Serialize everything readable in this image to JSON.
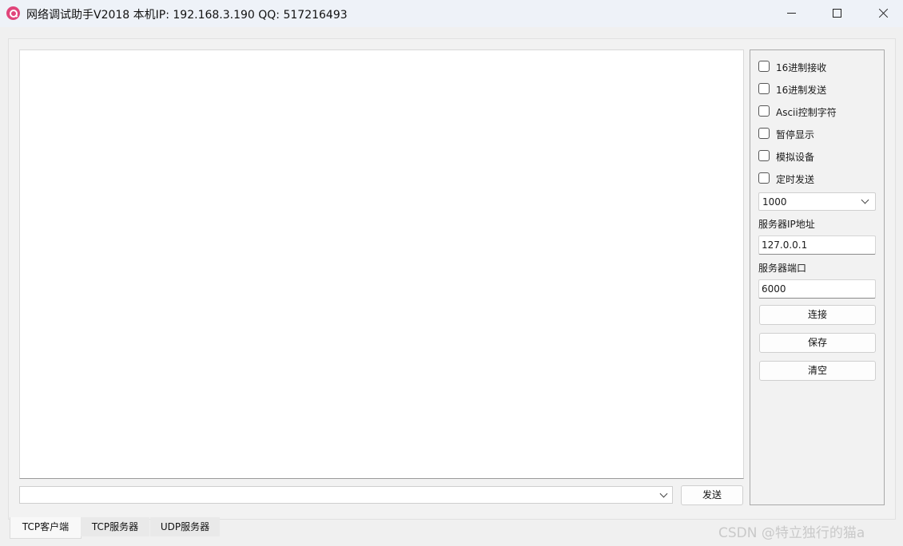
{
  "window": {
    "title": "网络调试助手V2018  本机IP: 192.168.3.190  QQ: 517216493"
  },
  "send": {
    "input_value": "",
    "send_label": "发送"
  },
  "options": [
    {
      "label": "16进制接收",
      "checked": false
    },
    {
      "label": "16进制发送",
      "checked": false
    },
    {
      "label": "Ascii控制字符",
      "checked": false
    },
    {
      "label": "暂停显示",
      "checked": false
    },
    {
      "label": "模拟设备",
      "checked": false
    },
    {
      "label": "定时发送",
      "checked": false
    }
  ],
  "interval": {
    "value": "1000"
  },
  "server_ip": {
    "label": "服务器IP地址",
    "value": "127.0.0.1"
  },
  "server_port": {
    "label": "服务器端口",
    "value": "6000"
  },
  "buttons": {
    "connect": "连接",
    "save": "保存",
    "clear": "清空"
  },
  "tabs": [
    {
      "label": "TCP客户端",
      "active": true
    },
    {
      "label": "TCP服务器",
      "active": false
    },
    {
      "label": "UDP服务器",
      "active": false
    }
  ],
  "watermark": "CSDN @特立独行的猫a",
  "colors": {
    "app_icon": "#e0457b",
    "panel_border": "#a9a9a9"
  }
}
